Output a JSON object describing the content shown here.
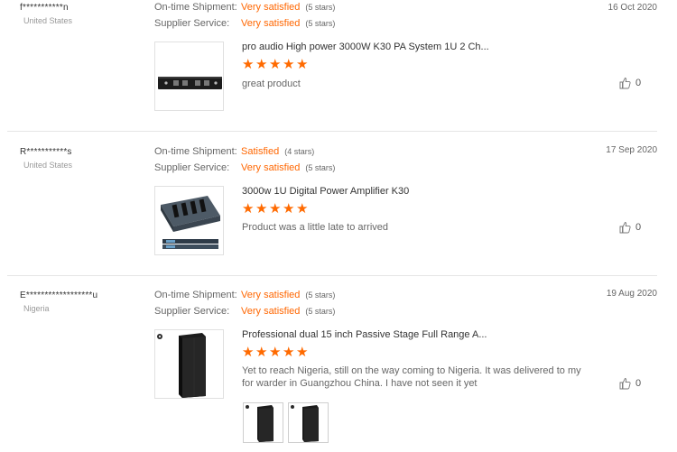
{
  "labels": {
    "shipment": "On-time Shipment:",
    "service": "Supplier Service:"
  },
  "reviews": [
    {
      "buyer": "f***********n",
      "country": "United States",
      "shipment_value": "Very satisfied",
      "shipment_stars": "(5 stars)",
      "service_value": "Very satisfied",
      "service_stars": "(5 stars)",
      "date": "16 Oct 2020",
      "product": "pro audio High power 3000W K30 PA System 1U 2 Ch...",
      "rating": 5,
      "comment": "great product",
      "likes": "0"
    },
    {
      "buyer": "R***********s",
      "country": "United States",
      "shipment_value": "Satisfied",
      "shipment_stars": "(4 stars)",
      "service_value": "Very satisfied",
      "service_stars": "(5 stars)",
      "date": "17 Sep 2020",
      "product": "3000w 1U Digital Power Amplifier K30",
      "rating": 5,
      "comment": "Product was a little late to arrived",
      "likes": "0"
    },
    {
      "buyer": "E******************u",
      "country": "Nigeria",
      "shipment_value": "Very satisfied",
      "shipment_stars": "(5 stars)",
      "service_value": "Very satisfied",
      "service_stars": "(5 stars)",
      "date": "19 Aug 2020",
      "product": "Professional dual 15 inch Passive Stage Full Range A...",
      "rating": 5,
      "comment": "Yet to reach Nigeria, still on the way coming to Nigeria. It was delivered to my for warder in Guangzhou China. I have not seen it yet",
      "likes": "0"
    }
  ],
  "colors": {
    "accent": "#ff6a00",
    "muted": "#999999"
  }
}
